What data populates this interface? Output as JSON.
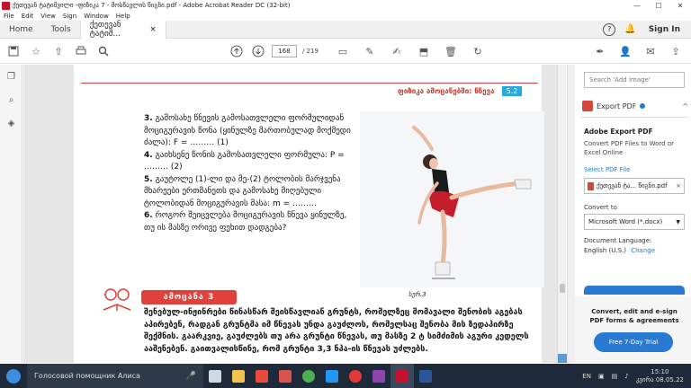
{
  "window": {
    "title": "ქეთევან ტატიშვილი -ფიზიკა 7 - მოსწავლის წიგნი.pdf - Adobe Acrobat Reader DC (32-bit)",
    "controls": [
      "—",
      "☐",
      "✕"
    ]
  },
  "menu": [
    "File",
    "Edit",
    "View",
    "Sign",
    "Window",
    "Help"
  ],
  "tabs": {
    "home": "Home",
    "tools": "Tools",
    "document": "ქეთევან ტატიშ...",
    "document_close": "×",
    "help": "?",
    "bell": "🔔",
    "signin": "Sign In"
  },
  "toolbar": {
    "current_page": "168",
    "total_pages": "/ 219"
  },
  "document": {
    "header_title": "ფიზიკა ამოცანებში: წნევა",
    "header_number": "5.2",
    "questions": [
      {
        "num": "3.",
        "text": "გამოსახე წნევის გამოსათვლელი ფორმულიდან მოციგურავის წონა (ყინულზე მართობულად მოქმედი ძალა): F = ……… (1)"
      },
      {
        "num": "4.",
        "text": "გაიხსენე წონის გამოსათვლელი ფორმულა: P = ……… (2)"
      },
      {
        "num": "5.",
        "text": "გაუტოლე (1)-ლი და მე-(2) ტოლობის მარჯვენა მხარეები ერთმანეთს და გამოსახე მიღებული ტოლობიდან მოციგურავის მასა: m = ………"
      },
      {
        "num": "6.",
        "text": "როგორ შეიცვლება მოციგურავის წნევა ყინულზე, თუ ის მასზე ორივე ფეხით დადგება?"
      }
    ],
    "photo_caption": "სურ.3",
    "activity_badge": "ამოცანა 3",
    "activity_text": "შენებულ-ინჟინრები წინასწარ შეისწავლიან გრუნტს, რომელზეც მომავალი შენობის აგებას აპირებენ, რადგან გრუნტმა იმ წნევას უნდა გაუძლოს, რომელსაც შენობა მის ზედაპირზე შექმნის. გაარკვიე, გაუძლებს თუ არა გრუნტი წნევას, თუ მასზე 2 ტ სიმძიმის აგური კედელს ააშენებენ. გაითვალისწინე, რომ გრუნტი 3,3 ნპა-ის წნევას უძლებს."
  },
  "right_panel": {
    "search_placeholder": "Search 'Add Image'",
    "export_label": "Export PDF",
    "chevron": "^",
    "title": "Adobe Export PDF",
    "description": "Convert PDF Files to Word or Excel Online",
    "select_link": "Select PDF File",
    "file_name": "ქეთევან ტა... წიგნი.pdf",
    "file_close": "×",
    "convert_to_label": "Convert to",
    "convert_to_value": "Microsoft Word (*.docx)",
    "language_label": "Document Language:",
    "language_value": "English (U.S.)",
    "language_change": "Change",
    "promo_text": "Convert, edit and e-sign PDF forms & agreements",
    "trial_button": "Free 7-Day Trial"
  },
  "taskbar": {
    "search_text": "Голосовой помощник Алиса",
    "lang": "EN",
    "time": "15:10",
    "date": "კვირა 08.05.22"
  }
}
